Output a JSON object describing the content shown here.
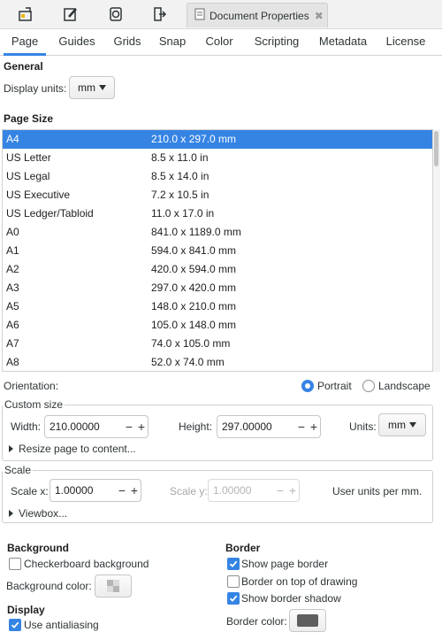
{
  "dock": {
    "icons": [
      "document-properties-icon",
      "edit-path-icon",
      "clone-icon",
      "export-icon"
    ],
    "tab_title": "Document Properties",
    "tab_close": "✖"
  },
  "tabs": [
    "Page",
    "Guides",
    "Grids",
    "Snap",
    "Color",
    "Scripting",
    "Metadata",
    "License"
  ],
  "active_tab": 0,
  "general": {
    "title": "General",
    "display_units_label": "Display units:",
    "display_units_value": "mm"
  },
  "page_size": {
    "title": "Page Size",
    "selected_index": 0,
    "rows": [
      {
        "name": "A4",
        "size": "210.0 x 297.0 mm"
      },
      {
        "name": "US Letter",
        "size": "8.5 x 11.0 in"
      },
      {
        "name": "US Legal",
        "size": "8.5 x 14.0 in"
      },
      {
        "name": "US Executive",
        "size": "7.2 x 10.5 in"
      },
      {
        "name": "US Ledger/Tabloid",
        "size": "11.0 x 17.0 in"
      },
      {
        "name": "A0",
        "size": "841.0 x 1189.0 mm"
      },
      {
        "name": "A1",
        "size": "594.0 x 841.0 mm"
      },
      {
        "name": "A2",
        "size": "420.0 x 594.0 mm"
      },
      {
        "name": "A3",
        "size": "297.0 x 420.0 mm"
      },
      {
        "name": "A5",
        "size": "148.0 x 210.0 mm"
      },
      {
        "name": "A6",
        "size": "105.0 x 148.0 mm"
      },
      {
        "name": "A7",
        "size": "74.0 x 105.0 mm"
      },
      {
        "name": "A8",
        "size": "52.0 x 74.0 mm"
      }
    ]
  },
  "orientation": {
    "label": "Orientation:",
    "portrait": "Portrait",
    "landscape": "Landscape",
    "selected": "portrait"
  },
  "custom_size": {
    "title": "Custom size",
    "width_label": "Width:",
    "width_value": "210.00000",
    "height_label": "Height:",
    "height_value": "297.00000",
    "units_label": "Units:",
    "units_value": "mm",
    "resize_label": "Resize page to content..."
  },
  "scale": {
    "title": "Scale",
    "scale_x_label": "Scale x:",
    "scale_x_value": "1.00000",
    "scale_y_label": "Scale y:",
    "scale_y_value": "1.00000",
    "user_units": "User units per mm.",
    "viewbox_label": "Viewbox..."
  },
  "background": {
    "title": "Background",
    "checkerboard_label": "Checkerboard background",
    "checkerboard": false,
    "color_label": "Background color:"
  },
  "display": {
    "title": "Display",
    "antialiasing_label": "Use antialiasing",
    "antialiasing": true
  },
  "border": {
    "title": "Border",
    "show_border_label": "Show page border",
    "show_border": true,
    "on_top_label": "Border on top of drawing",
    "on_top": false,
    "shadow_label": "Show border shadow",
    "shadow": true,
    "color_label": "Border color:",
    "color": "#5e5e5e"
  },
  "colors": {
    "accent": "#3584e4"
  }
}
